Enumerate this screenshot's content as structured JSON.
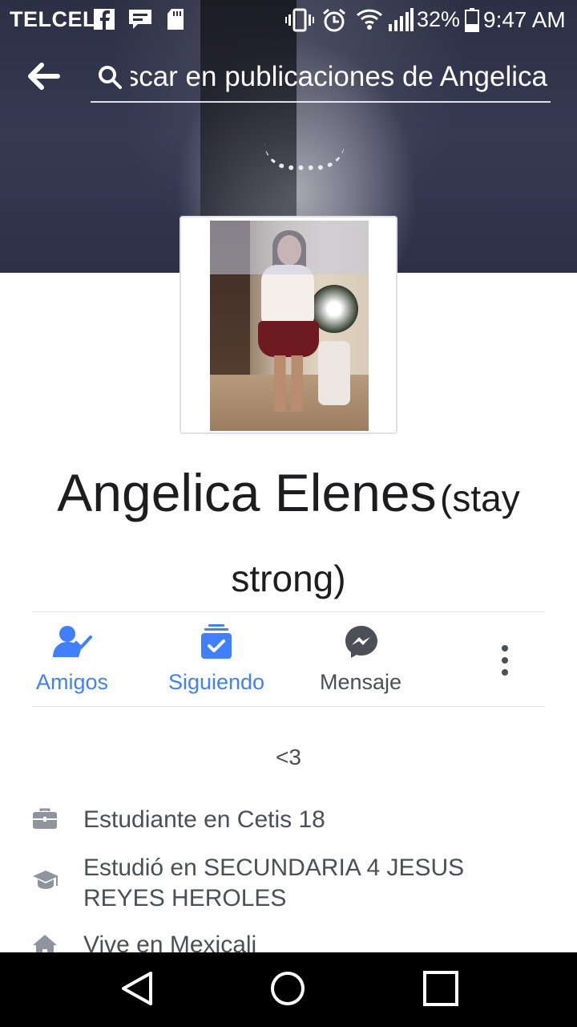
{
  "status_bar": {
    "carrier": "TELCEL",
    "battery_percent": "32%",
    "time": "9:47 AM"
  },
  "header": {
    "search_text": "Buscar en publicaciones de Angelica",
    "back_icon": "arrow-left-icon",
    "search_icon": "search-icon"
  },
  "profile": {
    "name": "Angelica Elenes",
    "alternate_name": "(stay strong)",
    "bio": "<3"
  },
  "actions": [
    {
      "label": "Amigos",
      "icon": "friends-check-icon",
      "color": "#4080ff"
    },
    {
      "label": "Siguiendo",
      "icon": "following-check-icon",
      "color": "#4080ff"
    },
    {
      "label": "Mensaje",
      "icon": "messenger-icon",
      "color": "#4b4f56"
    }
  ],
  "intro": [
    {
      "icon": "briefcase-icon",
      "text": "Estudiante en Cetis 18"
    },
    {
      "icon": "graduation-cap-icon",
      "text": "Estudió en SECUNDARIA 4 JESUS REYES HEROLES"
    },
    {
      "icon": "home-icon",
      "text": "Vive en Mexicali"
    }
  ],
  "colors": {
    "accent": "#4080ff",
    "text_secondary": "#4b4f56",
    "text_primary": "#1d1d1f",
    "divider": "#e1e3e8"
  }
}
